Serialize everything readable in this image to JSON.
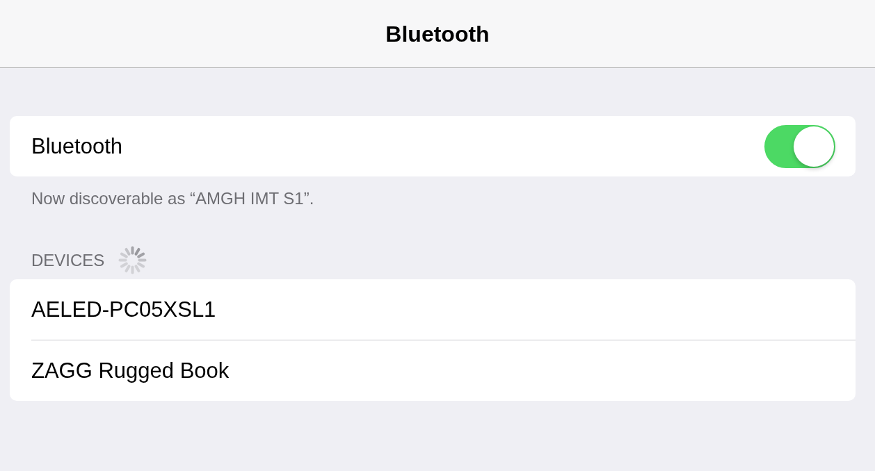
{
  "nav_bar": {
    "title": "Bluetooth"
  },
  "bluetooth": {
    "label": "Bluetooth",
    "on": true,
    "footer": "Now discoverable as “AMGH IMT S1”."
  },
  "devices": {
    "header": "DEVICES",
    "searching": true,
    "items": [
      {
        "name": "AELED-PC05XSL1"
      },
      {
        "name": "ZAGG Rugged Book"
      }
    ]
  }
}
